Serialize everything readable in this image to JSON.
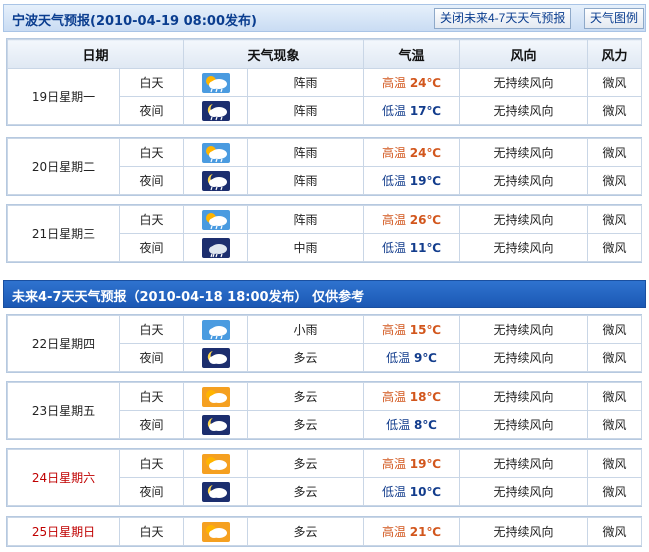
{
  "header1": {
    "title": "宁波天气预报(2010-04-19  08:00发布)",
    "btn_close": "关闭未来4-7天天气预报",
    "btn_legend": "天气图例"
  },
  "columns": [
    "日期",
    "天气现象",
    "气温",
    "风向",
    "风力"
  ],
  "day_label": "白天",
  "night_label": "夜间",
  "high_label": "高温",
  "low_label": "低温",
  "days1": [
    {
      "date": "19日星期一",
      "red": false,
      "day": {
        "icon": "shower-day-icon",
        "weather": "阵雨",
        "temp": "24℃",
        "wind_dir": "无持续风向",
        "wind": "微风"
      },
      "night": {
        "icon": "shower-night-icon",
        "weather": "阵雨",
        "temp": "17℃",
        "wind_dir": "无持续风向",
        "wind": "微风"
      }
    },
    {
      "date": "20日星期二",
      "red": false,
      "day": {
        "icon": "shower-day-icon",
        "weather": "阵雨",
        "temp": "24℃",
        "wind_dir": "无持续风向",
        "wind": "微风"
      },
      "night": {
        "icon": "shower-night-icon",
        "weather": "阵雨",
        "temp": "19℃",
        "wind_dir": "无持续风向",
        "wind": "微风"
      }
    },
    {
      "date": "21日星期三",
      "red": false,
      "day": {
        "icon": "shower-day-icon",
        "weather": "阵雨",
        "temp": "26℃",
        "wind_dir": "无持续风向",
        "wind": "微风"
      },
      "night": {
        "icon": "rain-icon",
        "weather": "中雨",
        "temp": "11℃",
        "wind_dir": "无持续风向",
        "wind": "微风"
      }
    }
  ],
  "header2": {
    "title": "未来4-7天天气预报（2010-04-18 18:00发布）   仅供参考"
  },
  "days2": [
    {
      "date": "22日星期四",
      "red": false,
      "day": {
        "icon": "light-rain-icon",
        "weather": "小雨",
        "temp": "15℃",
        "wind_dir": "无持续风向",
        "wind": "微风"
      },
      "night": {
        "icon": "cloudy-night-icon",
        "weather": "多云",
        "temp": "9℃",
        "wind_dir": "无持续风向",
        "wind": "微风"
      }
    },
    {
      "date": "23日星期五",
      "red": false,
      "day": {
        "icon": "cloudy-day-icon",
        "weather": "多云",
        "temp": "18℃",
        "wind_dir": "无持续风向",
        "wind": "微风"
      },
      "night": {
        "icon": "cloudy-night-icon",
        "weather": "多云",
        "temp": "8℃",
        "wind_dir": "无持续风向",
        "wind": "微风"
      }
    },
    {
      "date": "24日星期六",
      "red": true,
      "day": {
        "icon": "cloudy-day-icon",
        "weather": "多云",
        "temp": "19℃",
        "wind_dir": "无持续风向",
        "wind": "微风"
      },
      "night": {
        "icon": "cloudy-night-icon",
        "weather": "多云",
        "temp": "10℃",
        "wind_dir": "无持续风向",
        "wind": "微风"
      }
    },
    {
      "date": "25日星期日",
      "red": true,
      "day": {
        "icon": "cloudy-day-icon",
        "weather": "多云",
        "temp": "21℃",
        "wind_dir": "无持续风向",
        "wind": "微风"
      }
    }
  ]
}
